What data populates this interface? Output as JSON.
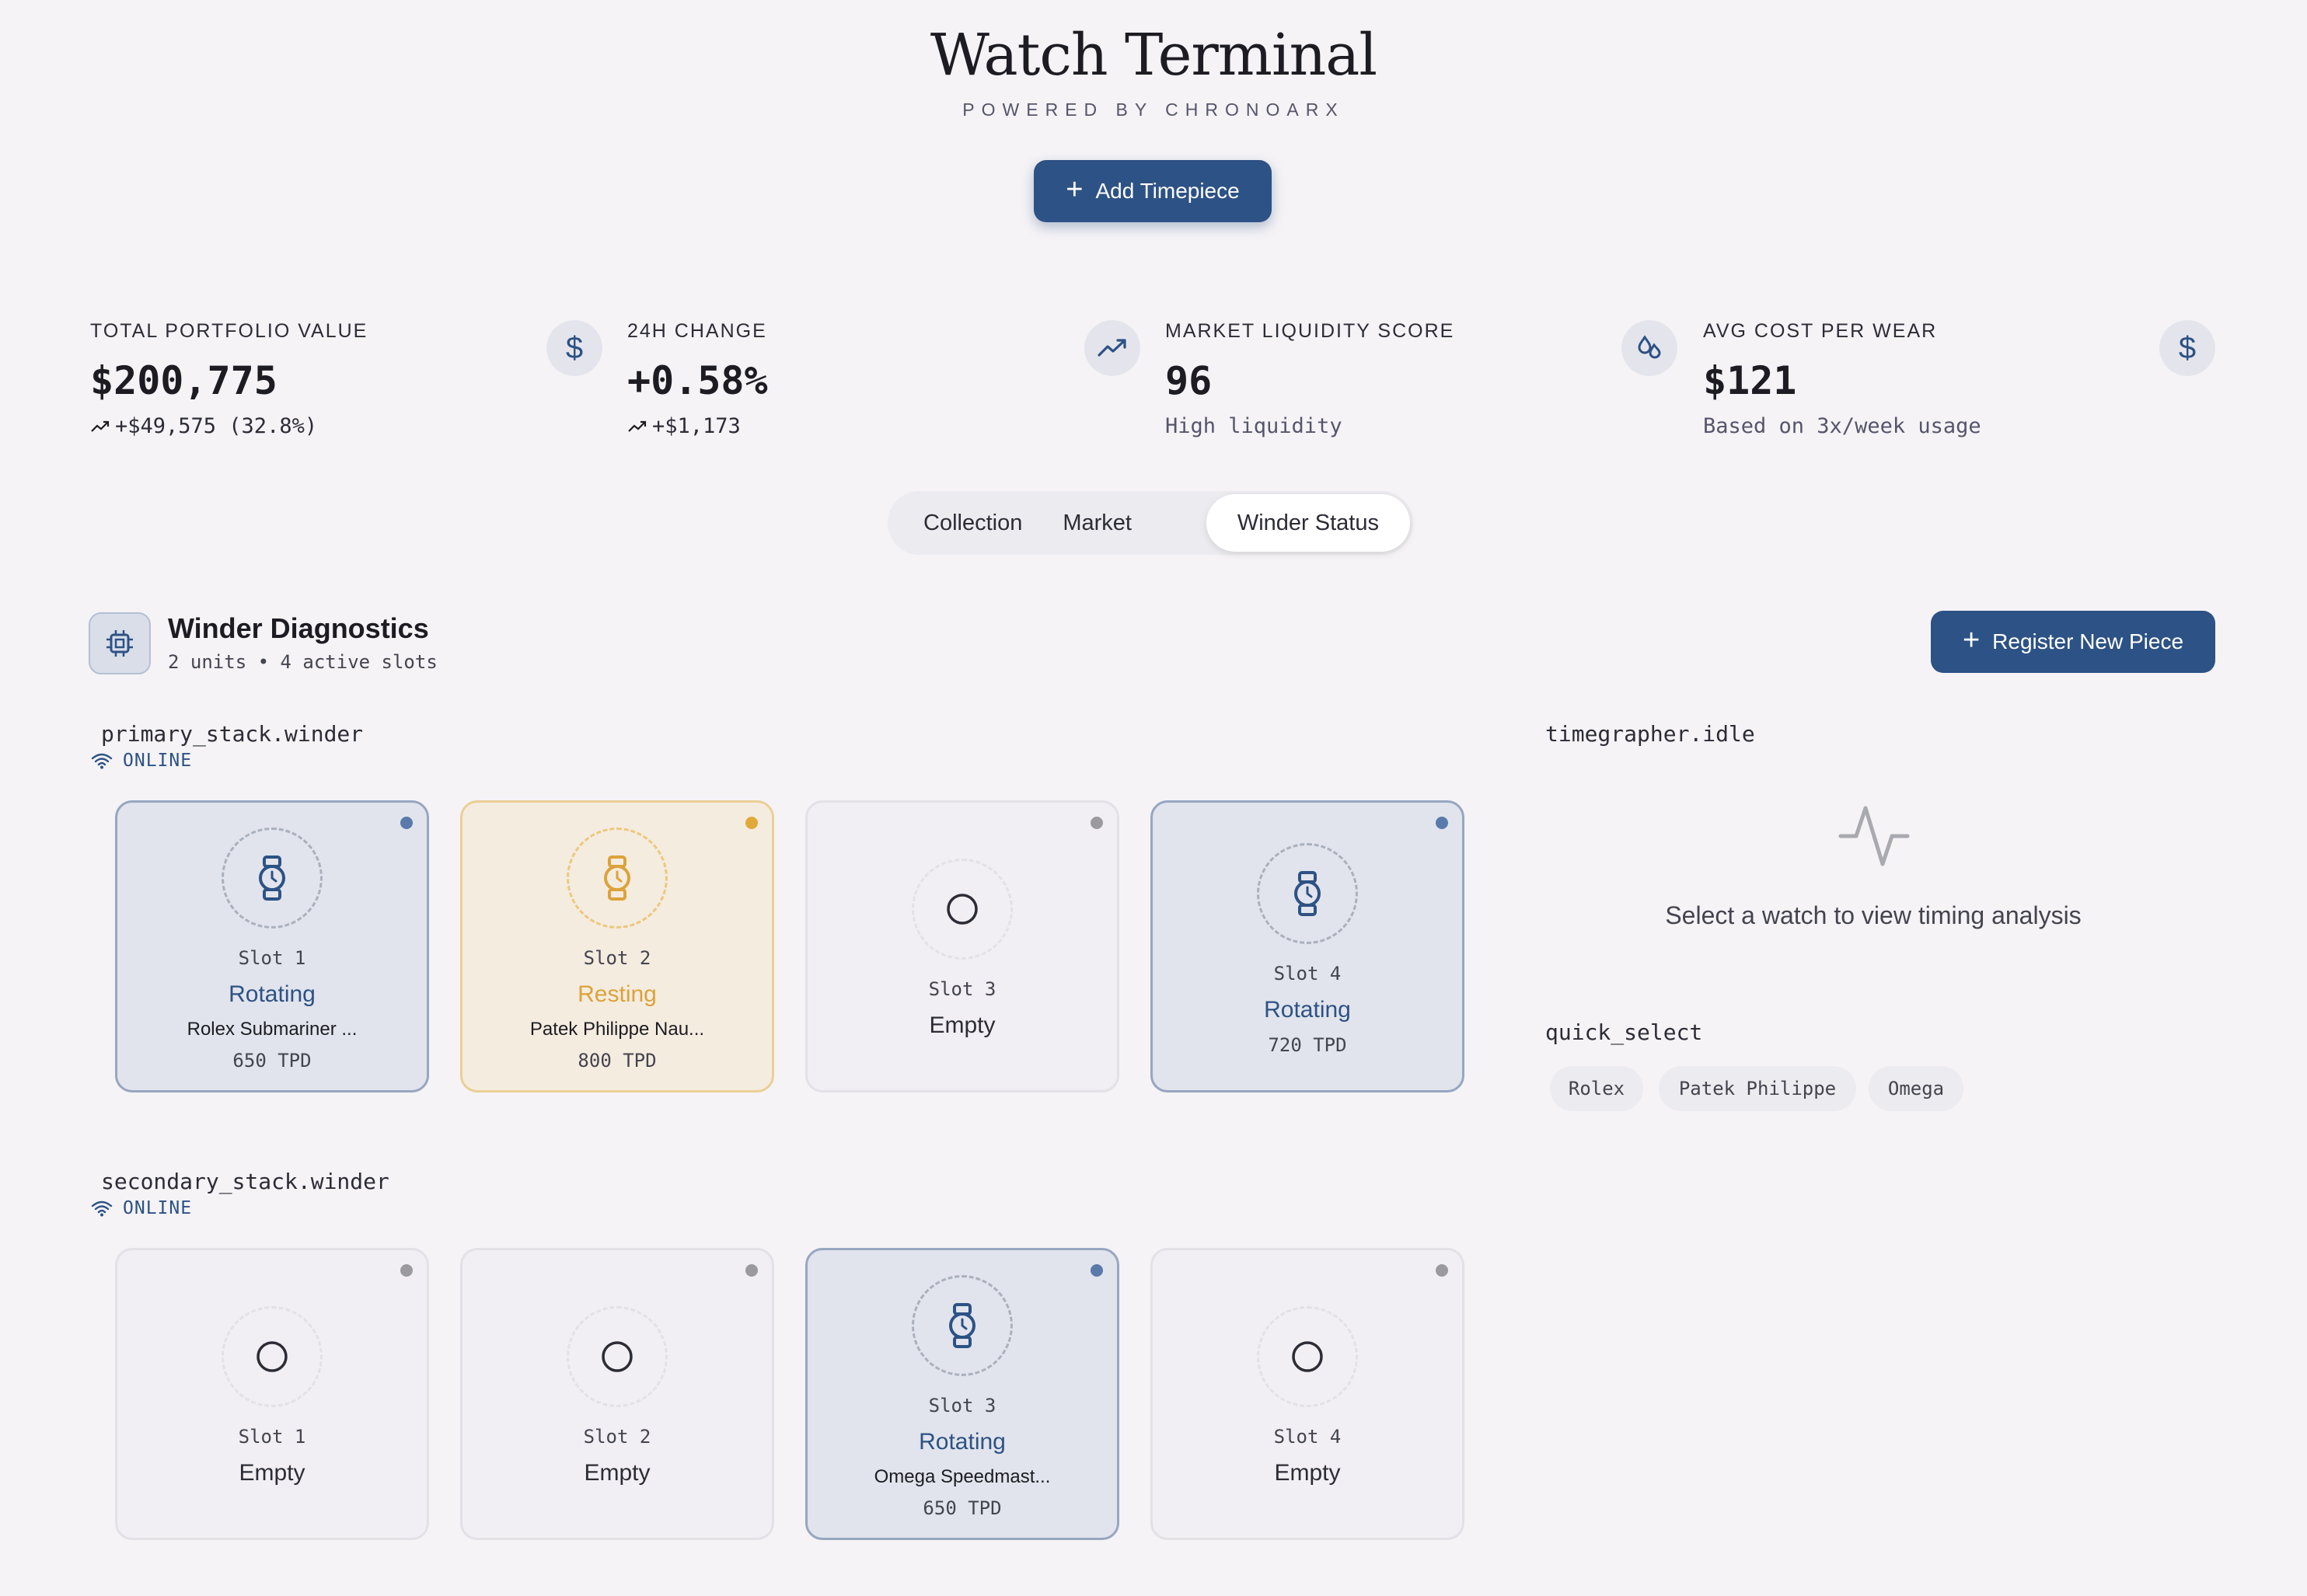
{
  "header": {
    "title": "Watch Terminal",
    "subtitle": "POWERED BY CHRONOARX",
    "add_button": "Add Timepiece"
  },
  "stats": [
    {
      "label": "TOTAL PORTFOLIO VALUE",
      "value": "$200,775",
      "sub": "+$49,575 (32.8%)",
      "icon": "dollar-icon"
    },
    {
      "label": "24H CHANGE",
      "value": "+0.58%",
      "sub": "+$1,173",
      "icon": "trending-up-icon"
    },
    {
      "label": "MARKET LIQUIDITY SCORE",
      "value": "96",
      "sub": "High liquidity",
      "icon": "droplets-icon"
    },
    {
      "label": "AVG COST PER WEAR",
      "value": "$121",
      "sub": "Based on 3x/week usage",
      "icon": "dollar-icon"
    }
  ],
  "tabs": [
    "Collection",
    "Market",
    "Winder Status"
  ],
  "active_tab": "Winder Status",
  "diagnostics": {
    "title": "Winder Diagnostics",
    "subtitle": "2 units • 4 active slots",
    "register_button": "Register New Piece"
  },
  "winders": [
    {
      "name": "primary_stack.winder",
      "status": "ONLINE",
      "slots": [
        {
          "label": "Slot 1",
          "state": "Rotating",
          "model": "Rolex Submariner ...",
          "tpd": "650 TPD"
        },
        {
          "label": "Slot 2",
          "state": "Resting",
          "model": "Patek Philippe Nau...",
          "tpd": "800 TPD"
        },
        {
          "label": "Slot 3",
          "state": "Empty"
        },
        {
          "label": "Slot 4",
          "state": "Rotating",
          "tpd": "720 TPD"
        }
      ]
    },
    {
      "name": "secondary_stack.winder",
      "status": "ONLINE",
      "slots": [
        {
          "label": "Slot 1",
          "state": "Empty"
        },
        {
          "label": "Slot 2",
          "state": "Empty"
        },
        {
          "label": "Slot 3",
          "state": "Rotating",
          "model": "Omega Speedmast...",
          "tpd": "650 TPD"
        },
        {
          "label": "Slot 4",
          "state": "Empty"
        }
      ]
    }
  ],
  "timegrapher": {
    "title": "timegrapher.idle",
    "message": "Select a watch to view timing analysis"
  },
  "quick_select": {
    "title": "quick_select",
    "chips": [
      "Rolex",
      "Patek Philippe",
      "Omega"
    ]
  },
  "colors": {
    "accent": "#2d5285",
    "resting": "#dca33a",
    "background": "#f5f3f6"
  }
}
